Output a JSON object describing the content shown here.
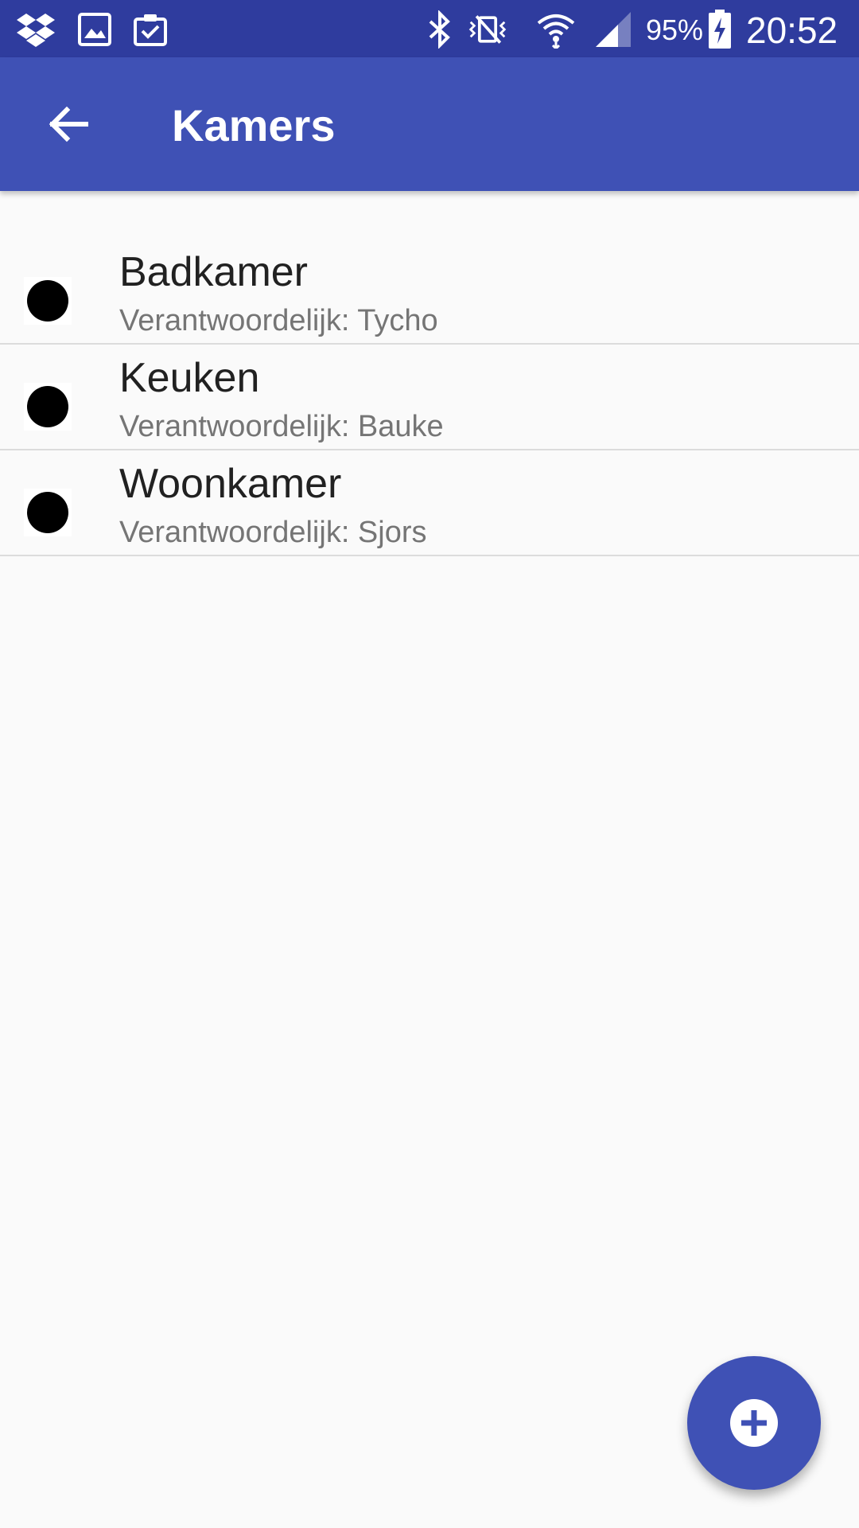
{
  "status_bar": {
    "battery_percent": "95%",
    "time": "20:52",
    "icons": [
      "dropbox-icon",
      "image-icon",
      "clipboard-check-icon",
      "bluetooth-icon",
      "vibrate-icon",
      "wifi-icon",
      "signal-icon",
      "battery-charging-icon"
    ]
  },
  "app_bar": {
    "title": "Kamers",
    "back_icon": "arrow-back-icon"
  },
  "rooms": [
    {
      "name": "Badkamer",
      "responsible": "Verantwoordelijk: Tycho"
    },
    {
      "name": "Keuken",
      "responsible": "Verantwoordelijk: Bauke"
    },
    {
      "name": "Woonkamer",
      "responsible": "Verantwoordelijk: Sjors"
    }
  ],
  "fab": {
    "icon": "add-circle-icon"
  },
  "colors": {
    "status_bar": "#2f3c9e",
    "primary": "#3f51b5",
    "background": "#fafafa",
    "primary_text": "#212121",
    "secondary_text": "#757575",
    "divider": "#dcdcdc"
  }
}
